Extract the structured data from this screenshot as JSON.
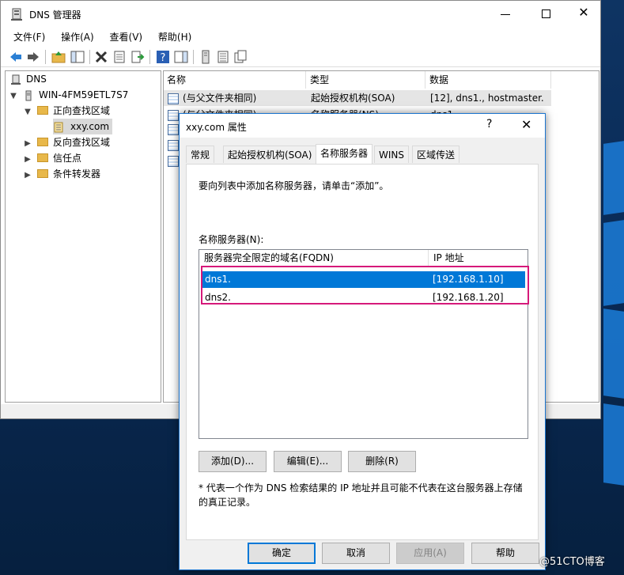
{
  "main_window": {
    "title": "DNS 管理器",
    "menu": [
      "文件(F)",
      "操作(A)",
      "查看(V)",
      "帮助(H)"
    ],
    "tree": {
      "root": "DNS",
      "server": "WIN-4FM59ETL7S7",
      "forward_zones": "正向查找区域",
      "zone": "xxy.com",
      "reverse_zones": "反向查找区域",
      "trust_points": "信任点",
      "conditional_forwarders": "条件转发器"
    },
    "list": {
      "columns": [
        "名称",
        "类型",
        "数据"
      ],
      "rows": [
        {
          "name": "(与父文件夹相同)",
          "type": "起始授权机构(SOA)",
          "data": "[12], dns1., hostmaster."
        },
        {
          "name": "(与父文件夹相同)",
          "type": "名称服务器(NS)",
          "data": "dns1."
        }
      ]
    }
  },
  "dialog": {
    "title": "xxy.com 属性",
    "help_glyph": "?",
    "tabs": [
      "常规",
      "起始授权机构(SOA)",
      "名称服务器",
      "WINS",
      "区域传送"
    ],
    "active_tab": "名称服务器",
    "instruction": "要向列表中添加名称服务器，请单击“添加”。",
    "list_label": "名称服务器(N):",
    "columns": [
      "服务器完全限定的域名(FQDN)",
      "IP 地址"
    ],
    "servers": [
      {
        "fqdn": "dns1.",
        "ip": "[192.168.1.10]",
        "selected": true
      },
      {
        "fqdn": "dns2.",
        "ip": "[192.168.1.20]",
        "selected": false
      }
    ],
    "buttons": {
      "add": "添加(D)...",
      "edit": "编辑(E)...",
      "remove": "删除(R)"
    },
    "note": "* 代表一个作为 DNS 检索结果的 IP 地址并且可能不代表在这台服务器上存储的真正记录。",
    "footer": {
      "ok": "确定",
      "cancel": "取消",
      "apply": "应用(A)",
      "help": "帮助"
    }
  },
  "watermark": "@51CTO博客",
  "colors": {
    "selection": "#0078d7",
    "highlight_box": "#d6197a",
    "dialog_border": "#1b75d0"
  }
}
